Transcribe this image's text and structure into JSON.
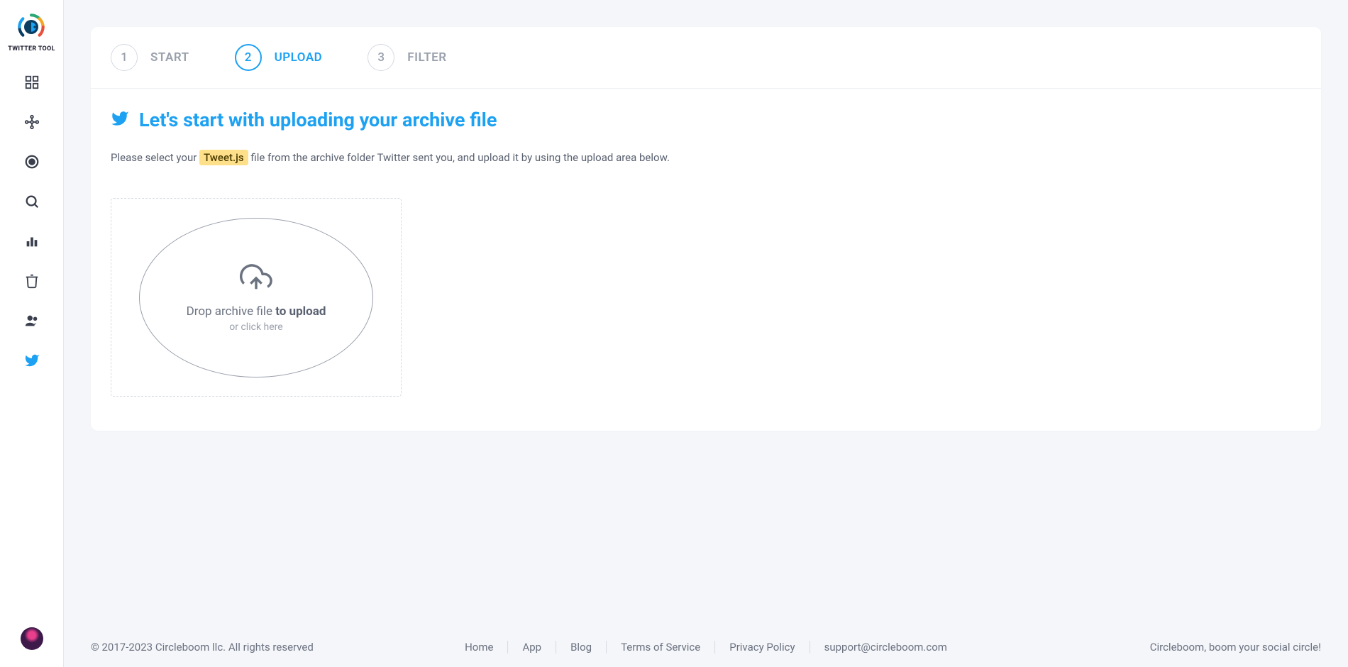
{
  "brand": {
    "name": "TWITTER TOOL"
  },
  "sidebar": {
    "items": [
      {
        "name": "dashboard-icon"
      },
      {
        "name": "network-icon"
      },
      {
        "name": "target-icon"
      },
      {
        "name": "search-icon"
      },
      {
        "name": "stats-icon"
      },
      {
        "name": "trash-icon"
      },
      {
        "name": "users-icon"
      },
      {
        "name": "twitter-icon"
      }
    ]
  },
  "steps": [
    {
      "num": "1",
      "label": "START",
      "active": false
    },
    {
      "num": "2",
      "label": "UPLOAD",
      "active": true
    },
    {
      "num": "3",
      "label": "FILTER",
      "active": false
    }
  ],
  "title": "Let's start with uploading your archive file",
  "instruction": {
    "pre": "Please select your ",
    "highlight": "Tweet.js",
    "post": " file from the archive folder Twitter sent you, and upload it by using the upload area below."
  },
  "dropzone": {
    "line1_pre": "Drop archive file ",
    "line1_bold": "to upload",
    "line2": "or click here"
  },
  "footer": {
    "copyright": "© 2017-2023 Circleboom llc. All rights reserved",
    "links": [
      "Home",
      "App",
      "Blog",
      "Terms of Service",
      "Privacy Policy",
      "support@circleboom.com"
    ],
    "tagline": "Circleboom, boom your social circle!"
  }
}
